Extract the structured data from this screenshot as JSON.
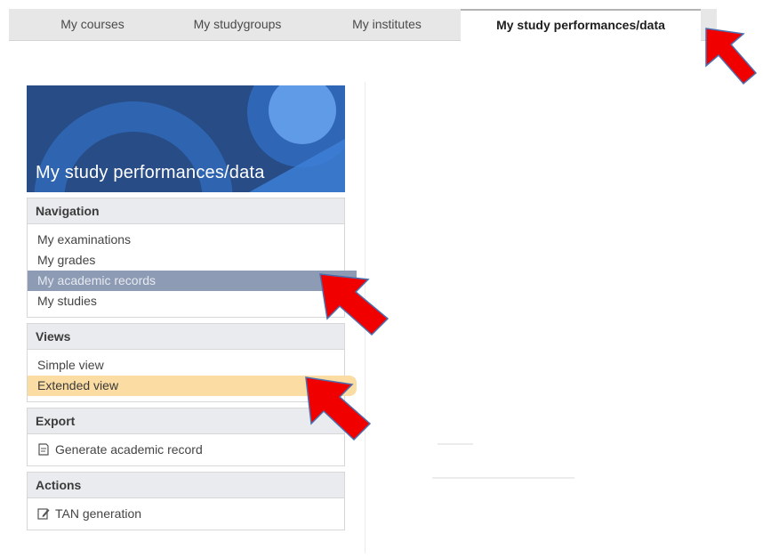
{
  "tabs": [
    {
      "label": "My courses",
      "active": false
    },
    {
      "label": "My studygroups",
      "active": false
    },
    {
      "label": "My institutes",
      "active": false
    },
    {
      "label": "My study performances/data",
      "active": true
    }
  ],
  "banner": {
    "title": "My study performances/data"
  },
  "navigation": {
    "heading": "Navigation",
    "items": [
      {
        "label": "My examinations"
      },
      {
        "label": "My grades"
      },
      {
        "label": "My academic records",
        "selected": true
      },
      {
        "label": "My studies"
      }
    ]
  },
  "views": {
    "heading": "Views",
    "items": [
      {
        "label": "Simple view"
      },
      {
        "label": "Extended view",
        "active": true
      }
    ]
  },
  "export": {
    "heading": "Export",
    "items": [
      {
        "label": "Generate academic record",
        "icon": "document-icon"
      }
    ]
  },
  "actions": {
    "heading": "Actions",
    "items": [
      {
        "label": "TAN generation",
        "icon": "edit-icon"
      }
    ]
  },
  "colors": {
    "banner_bg": "#274c86",
    "selected_item": "#8d9bb5",
    "active_view": "#fbdca2",
    "annotation_arrow": "#f10000"
  }
}
